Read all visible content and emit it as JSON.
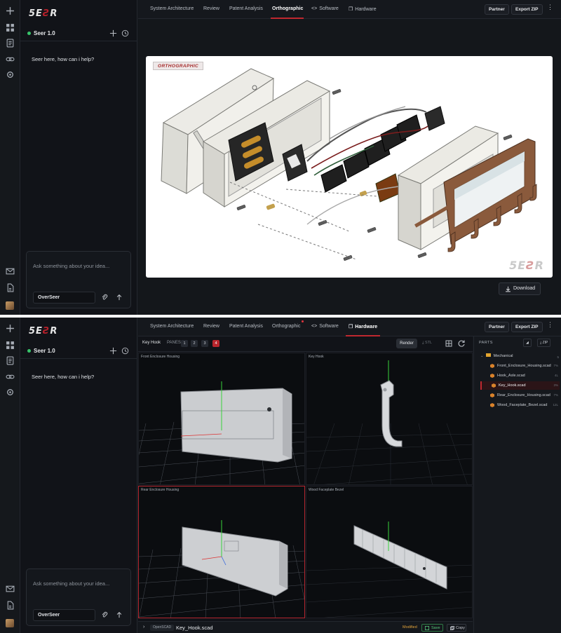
{
  "app": {
    "logo_left": "5E",
    "logo_mid": "Ƨ",
    "logo_right": "R",
    "model_name": "Seer 1.0",
    "greeting": "Seer here, how can i help?",
    "composer_placeholder": "Ask something about your idea...",
    "agent": "OverSeer",
    "partner_label": "Partner",
    "export_label": "Export ZIP",
    "more_label": "⋮"
  },
  "tabs": [
    {
      "label": "System Architecture"
    },
    {
      "label": "Review"
    },
    {
      "label": "Patent Analysis"
    },
    {
      "label": "Orthographic"
    },
    {
      "label": "Software",
      "glyph": "<>"
    },
    {
      "label": "Hardware",
      "glyph": "❒"
    }
  ],
  "orthographic": {
    "stamp": "ORTHOGRAPHIC",
    "watermark_left": "5E",
    "watermark_mid": "Ƨ",
    "watermark_right": "R",
    "download_label": "Download"
  },
  "hardware": {
    "active_part": "Key Hook",
    "panes_label": "PANES",
    "pane_numbers": [
      "1",
      "2",
      "3",
      "4"
    ],
    "active_pane": "4",
    "render_label": "Render",
    "stl_label": "STL",
    "viewports": [
      {
        "title": "Front Enclosure Housing"
      },
      {
        "title": "Key Hook"
      },
      {
        "title": "Rear Enclosure Housing"
      },
      {
        "title": "Wood Faceplate Bezel"
      }
    ],
    "footer": {
      "tag": "OpenSCAD",
      "filename": "Key_Hook.scad",
      "status": "Modified",
      "save_label": "Save",
      "copy_label": "Copy"
    }
  },
  "parts_panel": {
    "title": "PARTS",
    "zip_label": "ZIP",
    "folder": "Mechanical",
    "folder_count": "5",
    "files": [
      {
        "name": "Front_Enclosure_Housing.scad",
        "size": "7%"
      },
      {
        "name": "Hook_Axle.scad",
        "size": "4L"
      },
      {
        "name": "Key_Hook.scad",
        "size": "3%"
      },
      {
        "name": "Rear_Enclosure_Housing.scad",
        "size": "7%"
      },
      {
        "name": "Wood_Faceplate_Bezel.scad",
        "size": "12L"
      }
    ]
  },
  "colors": {
    "accent": "#c0282f",
    "online": "#37c46a",
    "modified": "#e1a23a",
    "save": "#58c97c",
    "folder": "#e3a52f"
  }
}
